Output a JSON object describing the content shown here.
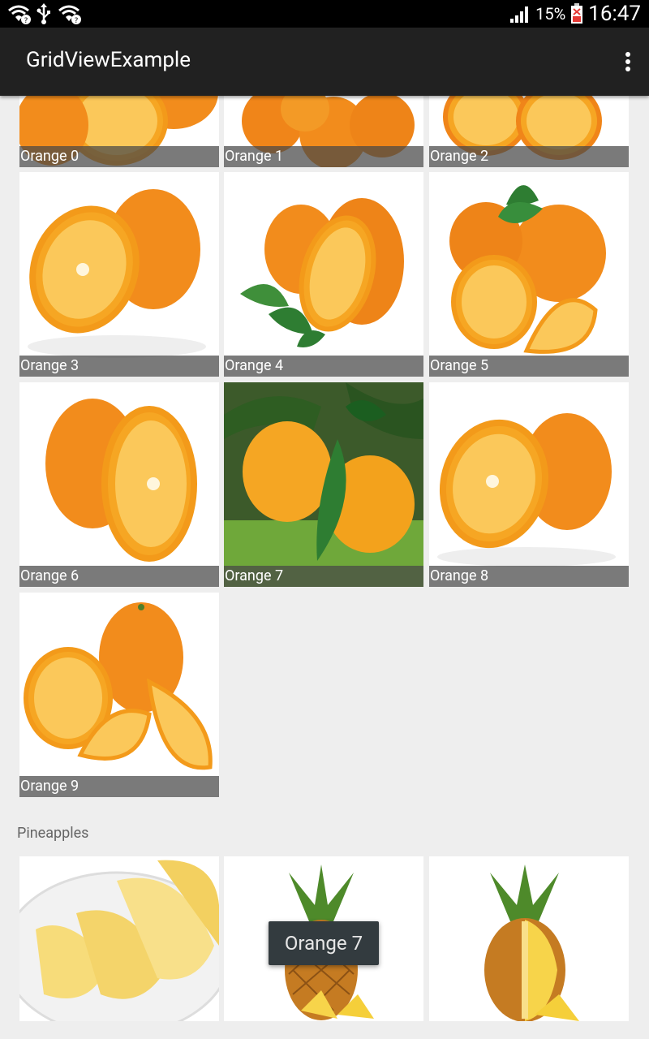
{
  "status_bar": {
    "left_icons": [
      "wifi-question-icon",
      "usb-icon",
      "wifi-question-icon"
    ],
    "signal": "signal-bars-icon",
    "battery_percent": "15%",
    "battery_icon": "battery-low-icon",
    "time": "16:47"
  },
  "app_bar": {
    "title": "GridViewExample",
    "overflow_icon": "overflow-menu-icon"
  },
  "oranges": [
    {
      "label": "Orange 0"
    },
    {
      "label": "Orange 1"
    },
    {
      "label": "Orange 2"
    },
    {
      "label": "Orange 3"
    },
    {
      "label": "Orange 4"
    },
    {
      "label": "Orange 5"
    },
    {
      "label": "Orange 6"
    },
    {
      "label": "Orange 7"
    },
    {
      "label": "Orange 8"
    },
    {
      "label": "Orange 9"
    }
  ],
  "pineapples_section": {
    "header": "Pineapples",
    "items": [
      {
        "image": "pineapple-slices"
      },
      {
        "image": "whole-pineapple"
      },
      {
        "image": "halved-pineapple"
      }
    ]
  },
  "toast": {
    "text": "Orange 7"
  },
  "colors": {
    "status_bar": "#000000",
    "app_bar": "#212121",
    "background": "#eeeeee",
    "caption_overlay": "#464646",
    "orange": "#f28c1c",
    "leaf": "#2e7d32"
  }
}
